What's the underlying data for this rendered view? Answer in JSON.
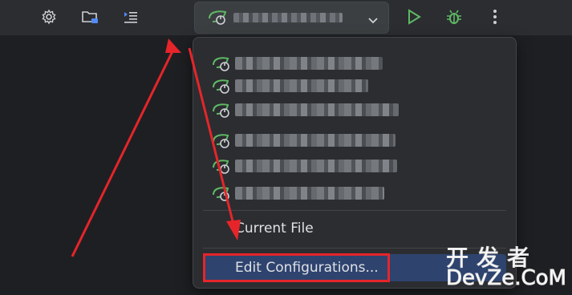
{
  "toolbar": {
    "icons": [
      "gear-icon",
      "project-folder-icon",
      "structure-icon",
      "run-icon",
      "debug-icon",
      "more-vertical-icon"
    ],
    "run_widget": {
      "icon": "spring-boot-icon",
      "selected_config": ""
    }
  },
  "popup": {
    "configurations": [
      {
        "icon": "spring-boot-icon",
        "label": ""
      },
      {
        "icon": "spring-boot-icon",
        "label": ""
      },
      {
        "icon": "spring-boot-icon",
        "label": ""
      },
      {
        "icon": "spring-boot-icon",
        "label": ""
      },
      {
        "icon": "spring-boot-icon",
        "label": ""
      },
      {
        "icon": "spring-boot-icon",
        "label": ""
      }
    ],
    "current_file_label": "Current File",
    "edit_configurations_label": "Edit Configurations..."
  },
  "annotation": {
    "highlight_color": "#e5252a"
  },
  "watermark": {
    "line1": "开发者",
    "line2": "DevZe.CoM"
  },
  "colors": {
    "accent_green": "#5fb865",
    "selection": "#2e436e"
  }
}
